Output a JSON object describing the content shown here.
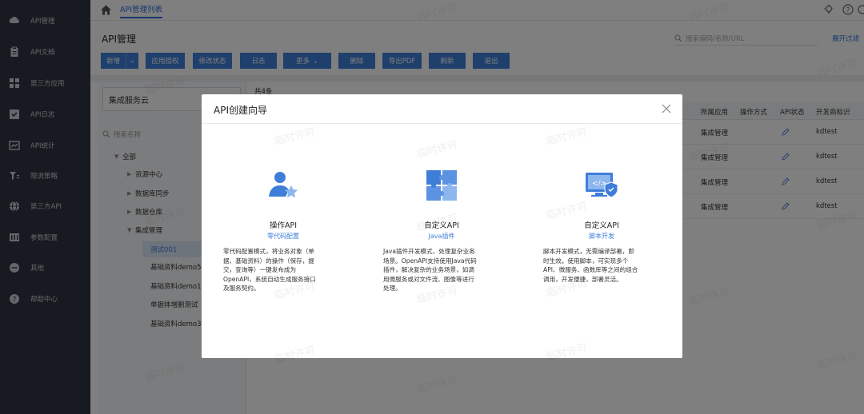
{
  "sidebar": {
    "items": [
      {
        "label": "API管理",
        "icon": "cloud-icon"
      },
      {
        "label": "API文档",
        "icon": "clipboard-icon"
      },
      {
        "label": "第三方应用",
        "icon": "grid-icon"
      },
      {
        "label": "API日志",
        "icon": "check-box-icon"
      },
      {
        "label": "API统计",
        "icon": "chart-icon"
      },
      {
        "label": "限流策略",
        "icon": "filter-icon"
      },
      {
        "label": "第三方API",
        "icon": "globe-icon"
      },
      {
        "label": "参数配置",
        "icon": "settings-panel-icon"
      },
      {
        "label": "其他",
        "icon": "more-icon"
      },
      {
        "label": "帮助中心",
        "icon": "help-icon"
      }
    ]
  },
  "topbar": {
    "tab": "API管理列表"
  },
  "main": {
    "title": "API管理",
    "search_placeholder": "搜索编码/名称/URL",
    "expand_filter": "展开过滤",
    "toolbar": {
      "new": "新增",
      "authorize": "应用授权",
      "modify_status": "修改状态",
      "log": "日志",
      "more": "更多",
      "delete": "删除",
      "export_pdf": "导出PDF",
      "refresh": "刷新",
      "exit": "退出"
    }
  },
  "tree": {
    "select_value": "集成服务云",
    "search_placeholder": "搜索名称",
    "nodes": {
      "all": "全部",
      "resource_center": "资源中心",
      "db_sync": "数据库同步",
      "data_warehouse": "数据仓库",
      "integration_mgmt": "集成管理",
      "test001": "测试001",
      "basic_demo5": "基础资料demo5",
      "basic_demo1": "基础资料demo1",
      "single_add_delete": "单据体增删测试",
      "basic_demo3": "基础资料demo3"
    }
  },
  "grid": {
    "count": "共4条",
    "headers": {
      "method": "式",
      "app": "所属应用",
      "operation": "操作方式",
      "status": "API状态",
      "developer": "开发商标识"
    },
    "rows": [
      {
        "method": "件",
        "app": "集成管理",
        "developer": "kdtest"
      },
      {
        "method": "件",
        "app": "集成管理",
        "developer": "kdtest"
      },
      {
        "method": "件",
        "app": "集成管理",
        "developer": "kdtest"
      },
      {
        "method": "件",
        "app": "集成管理",
        "developer": "kdtest"
      }
    ]
  },
  "modal": {
    "title": "API创建向导",
    "cards": [
      {
        "title": "操作API",
        "subtitle": "零代码配置",
        "desc_lines": [
          "零代码配置模式，将业务对象（单",
          "据、基础资料）的操作（保存，提",
          "交，查询等）一键发布成为",
          "OpenAPI，系统自动生成服务接口",
          "及服务契约。"
        ],
        "icon": "user-star-icon"
      },
      {
        "title": "自定义API",
        "subtitle": "Java插件",
        "desc_lines": [
          "Java插件开发模式，处理复杂业务",
          "场景。OpenAPI支持使用Java代码",
          "插件，解决复杂的业务场景，如调",
          "用微服务或对文件流、图像等进行",
          "处理。"
        ],
        "icon": "puzzle-icon"
      },
      {
        "title": "自定义API",
        "subtitle": "脚本开发",
        "desc_lines": [
          "脚本开发模式，无需编译部署，即",
          "时生效。使用脚本，可实现多个",
          "API、微服务、函数库等之间的组合",
          "调用，开发便捷，部署灵活。"
        ],
        "icon": "code-shield-icon"
      }
    ]
  },
  "watermark_text": "临时许可",
  "colors": {
    "accent": "#3e7ed8",
    "sidebar_bg": "#2f3540"
  }
}
